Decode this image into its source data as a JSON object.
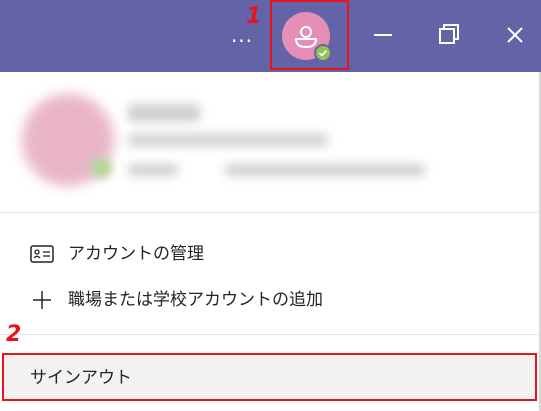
{
  "titlebar": {
    "bg_color": "#6264a7",
    "more_label": "...",
    "avatar_icon": "user-avatar-icon",
    "status": "available"
  },
  "annotations": {
    "step1": "1",
    "step2": "2",
    "highlight_color": "#e8141d"
  },
  "menu": {
    "manage_account": "アカウントの管理",
    "add_account": "職場または学校アカウントの追加",
    "sign_out": "サインアウト"
  }
}
